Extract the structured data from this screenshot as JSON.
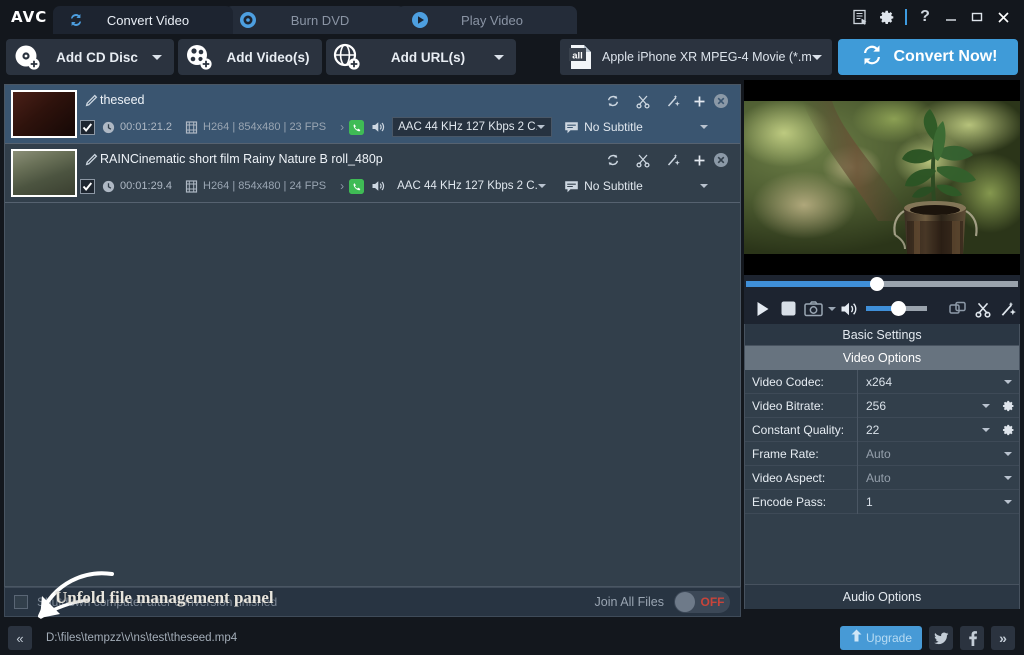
{
  "app": {
    "logo": "AVC",
    "tabs": [
      {
        "label": "Convert Video",
        "icon": "convert-icon",
        "active": true
      },
      {
        "label": "Burn DVD",
        "icon": "disc-icon",
        "active": false
      },
      {
        "label": "Play Video",
        "icon": "play-icon",
        "active": false
      }
    ],
    "window_controls": [
      {
        "name": "register-icon",
        "glyph": ""
      },
      {
        "name": "settings-gear-icon",
        "glyph": ""
      },
      {
        "name": "help-icon",
        "glyph": "?"
      },
      {
        "name": "minimize-icon",
        "glyph": "—"
      },
      {
        "name": "maximize-icon",
        "glyph": "□"
      },
      {
        "name": "close-icon",
        "glyph": "✕"
      }
    ]
  },
  "toolbar": {
    "add_cd_disc": "Add CD Disc",
    "add_videos": "Add Video(s)",
    "add_urls": "Add URL(s)",
    "profile": "Apple iPhone XR MPEG-4 Movie (*.m...",
    "profile_icon": "all-format-icon",
    "convert_now": "Convert Now!",
    "accent": "#3f9bd8"
  },
  "files": [
    {
      "name": "theseed",
      "selected": true,
      "checked": true,
      "duration": "00:01:21.2",
      "video_info": "H264 | 854x480 | 23 FPS",
      "audio": "AAC 44 KHz 127 Kbps 2 C...",
      "subtitle": "No Subtitle",
      "thumb": "seedling-thumbnail"
    },
    {
      "name": "RAINCinematic short film  Rainy Nature B roll_480p",
      "selected": false,
      "checked": true,
      "duration": "00:01:29.4",
      "video_info": "H264 | 854x480 | 24 FPS",
      "audio": "AAC 44 KHz 127 Kbps 2 C...",
      "subtitle": "No Subtitle",
      "thumb": "rain-thumbnail"
    }
  ],
  "row_actions": [
    {
      "name": "rotate-icon"
    },
    {
      "name": "cut-icon"
    },
    {
      "name": "effects-icon"
    },
    {
      "name": "add-icon"
    },
    {
      "name": "remove-icon"
    }
  ],
  "options_bar": {
    "shutdown_label": "Shutdown computer after conversion finished",
    "shutdown_checked": false,
    "join_label": "Join All Files",
    "join_state": "OFF"
  },
  "player": {
    "seek_percent": 47,
    "volume_percent": 47,
    "controls": [
      {
        "name": "play-button"
      },
      {
        "name": "stop-button"
      },
      {
        "name": "snapshot-button"
      },
      {
        "name": "snapshot-dropdown"
      },
      {
        "name": "volume-icon"
      },
      {
        "name": "fullscreen-button"
      },
      {
        "name": "cut-button"
      },
      {
        "name": "effects-button"
      }
    ]
  },
  "settings": {
    "basic_settings": "Basic Settings",
    "video_options": "Video Options",
    "audio_options": "Audio Options",
    "rows": [
      {
        "label": "Video Codec:",
        "value": "x264",
        "muted": false,
        "gear": false
      },
      {
        "label": "Video Bitrate:",
        "value": "256",
        "muted": false,
        "gear": true
      },
      {
        "label": "Constant Quality:",
        "value": "22",
        "muted": false,
        "gear": true
      },
      {
        "label": "Frame Rate:",
        "value": "Auto",
        "muted": true,
        "gear": false
      },
      {
        "label": "Video Aspect:",
        "value": "Auto",
        "muted": true,
        "gear": false
      },
      {
        "label": "Encode Pass:",
        "value": "1",
        "muted": false,
        "gear": false
      }
    ]
  },
  "status_bar": {
    "collapse_glyph": "«",
    "path": "D:\\files\\tempzz\\v\\ns\\test\\theseed.mp4",
    "upgrade": "Upgrade",
    "twitter": "twitter-icon",
    "facebook": "facebook-icon",
    "more_glyph": "»"
  },
  "annotation": {
    "text": "Unfold file management panel"
  }
}
